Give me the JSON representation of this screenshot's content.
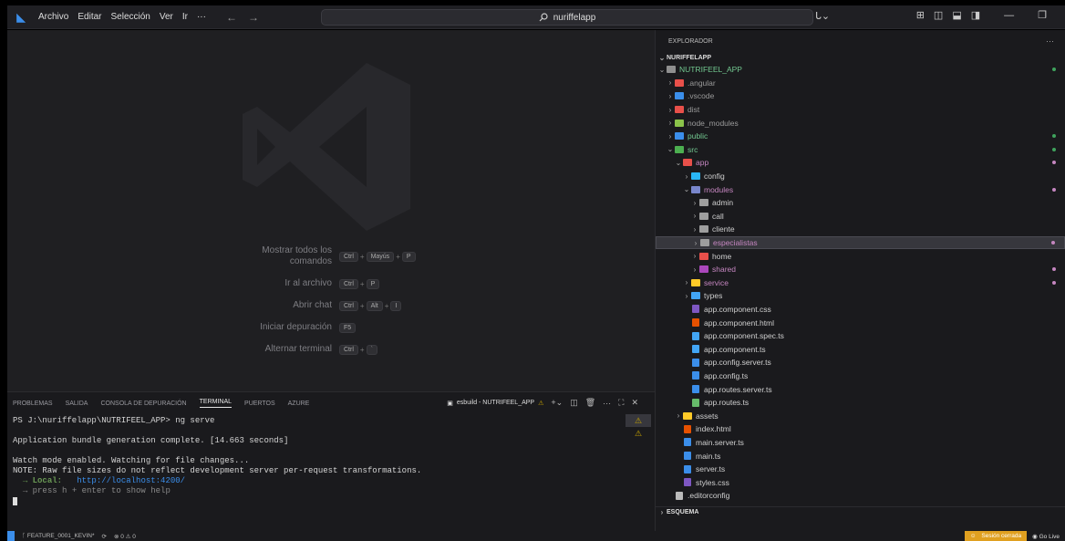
{
  "titlebar": {
    "menu": [
      "Archivo",
      "Editar",
      "Selección",
      "Ver",
      "Ir",
      "···"
    ],
    "search": "nuriffelapp",
    "account": "ᒐ⌄"
  },
  "editor": {
    "shortcuts": [
      {
        "label": "Mostrar todos los comandos",
        "keys": [
          "Ctrl",
          "Mayús",
          "P"
        ]
      },
      {
        "label": "Ir al archivo",
        "keys": [
          "Ctrl",
          "P"
        ]
      },
      {
        "label": "Abrir chat",
        "keys": [
          "Ctrl",
          "Alt",
          "I"
        ]
      },
      {
        "label": "Iniciar depuración",
        "keys": [
          "F5"
        ]
      },
      {
        "label": "Alternar terminal",
        "keys": [
          "Ctrl",
          "`"
        ]
      }
    ]
  },
  "panel": {
    "tabs": [
      "PROBLEMAS",
      "SALIDA",
      "CONSOLA DE DEPURACIÓN",
      "TERMINAL",
      "PUERTOS",
      "AZURE"
    ],
    "active_tab": "TERMINAL",
    "task": "esbuild - NUTRIFEEL_APP",
    "terminal": {
      "prompt": "PS J:\\nuriffelapp\\NUTRIFEEL_APP> ng serve",
      "line1": "Application bundle generation complete. [14.663 seconds]",
      "line2": "Watch mode enabled. Watching for file changes...",
      "line3": "NOTE: Raw file sizes do not reflect development server per-request transformations.",
      "local_label": "→ Local:",
      "local_url": "http://localhost:4200/",
      "help": "→ press h + enter to show help"
    }
  },
  "statusbar": {
    "branch": "FEATURE_0001_KEVIN*",
    "problems": "⊗ 0 ⚠ 0",
    "session": "Sesión cerrada",
    "golive": "Go Live"
  },
  "explorer": {
    "title": "EXPLORADOR",
    "root": "NURIFFELAPP",
    "project": "NUTRIFEEL_APP",
    "footer": "ESQUEMA",
    "items": [
      {
        "label": ".angular",
        "color": "#e8504a",
        "kind": "folder",
        "level": 1
      },
      {
        "label": ".vscode",
        "color": "#3b8eea",
        "kind": "folder",
        "level": 1
      },
      {
        "label": "dist",
        "color": "#e8504a",
        "kind": "folder",
        "level": 1
      },
      {
        "label": "node_modules",
        "color": "#8bc34a",
        "kind": "folder",
        "level": 1
      },
      {
        "label": "public",
        "color": "#3b8eea",
        "kind": "folder",
        "level": 1,
        "green": true
      },
      {
        "label": "src",
        "color": "#4caf50",
        "kind": "folder-open",
        "level": 1,
        "green": true
      },
      {
        "label": "app",
        "color": "#e8504a",
        "kind": "folder-open",
        "level": 2,
        "pink": true
      },
      {
        "label": "config",
        "color": "#29b6f6",
        "kind": "folder",
        "level": 3
      },
      {
        "label": "modules",
        "color": "#7986cb",
        "kind": "folder-open",
        "level": 3,
        "pink": true
      },
      {
        "label": "admin",
        "color": "#9e9e9e",
        "kind": "folder",
        "level": 4
      },
      {
        "label": "call",
        "color": "#9e9e9e",
        "kind": "folder",
        "level": 4
      },
      {
        "label": "cliente",
        "color": "#9e9e9e",
        "kind": "folder",
        "level": 4
      },
      {
        "label": "especialistas",
        "color": "#9e9e9e",
        "kind": "folder",
        "level": 4,
        "pink": true,
        "selected": true
      },
      {
        "label": "home",
        "color": "#e8504a",
        "kind": "folder",
        "level": 4
      },
      {
        "label": "shared",
        "color": "#ab47bc",
        "kind": "folder",
        "level": 4,
        "pink": true
      },
      {
        "label": "service",
        "color": "#ffca28",
        "kind": "folder",
        "level": 3,
        "pink": true
      },
      {
        "label": "types",
        "color": "#42a5f5",
        "kind": "folder",
        "level": 3
      },
      {
        "label": "app.component.css",
        "color": "#7e57c2",
        "kind": "file",
        "level": 3
      },
      {
        "label": "app.component.html",
        "color": "#e65100",
        "kind": "file",
        "level": 3
      },
      {
        "label": "app.component.spec.ts",
        "color": "#42a5f5",
        "kind": "file",
        "level": 3
      },
      {
        "label": "app.component.ts",
        "color": "#42a5f5",
        "kind": "file",
        "level": 3
      },
      {
        "label": "app.config.server.ts",
        "color": "#3b8eea",
        "kind": "file",
        "level": 3
      },
      {
        "label": "app.config.ts",
        "color": "#3b8eea",
        "kind": "file",
        "level": 3
      },
      {
        "label": "app.routes.server.ts",
        "color": "#3b8eea",
        "kind": "file",
        "level": 3
      },
      {
        "label": "app.routes.ts",
        "color": "#66bb6a",
        "kind": "file",
        "level": 3
      },
      {
        "label": "assets",
        "color": "#ffca28",
        "kind": "folder",
        "level": 2
      },
      {
        "label": "index.html",
        "color": "#e65100",
        "kind": "file",
        "level": 2
      },
      {
        "label": "main.server.ts",
        "color": "#3b8eea",
        "kind": "file",
        "level": 2
      },
      {
        "label": "main.ts",
        "color": "#3b8eea",
        "kind": "file",
        "level": 2
      },
      {
        "label": "server.ts",
        "color": "#3b8eea",
        "kind": "file",
        "level": 2
      },
      {
        "label": "styles.css",
        "color": "#7e57c2",
        "kind": "file",
        "level": 2
      },
      {
        "label": ".editorconfig",
        "color": "#bbbbbb",
        "kind": "file",
        "level": 1
      }
    ]
  }
}
